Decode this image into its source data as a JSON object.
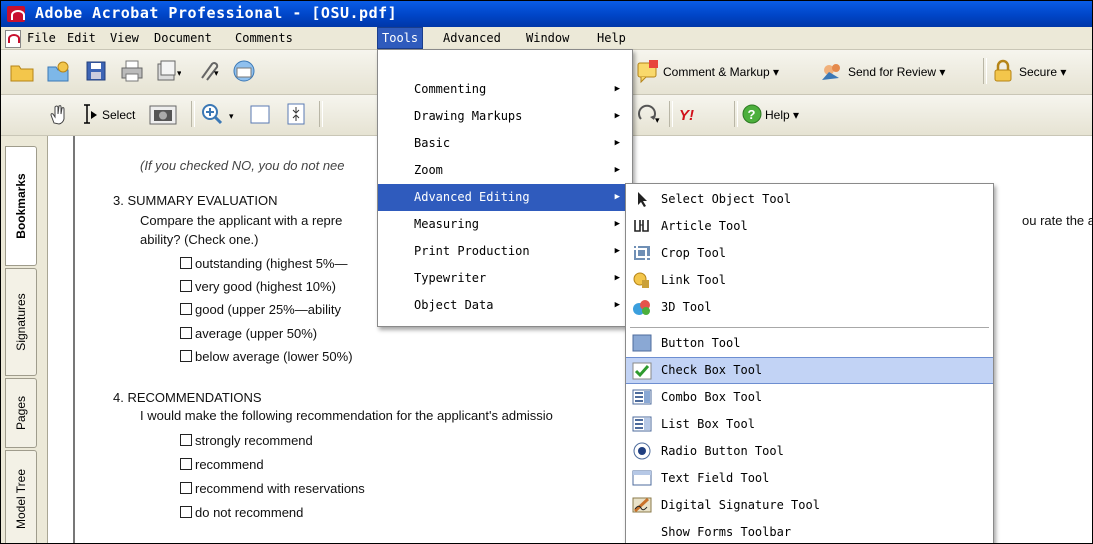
{
  "window": {
    "title": "Adobe Acrobat Professional - [OSU.pdf]"
  },
  "menubar": {
    "items": [
      {
        "label": "File"
      },
      {
        "label": "Edit"
      },
      {
        "label": "View"
      },
      {
        "label": "Document"
      },
      {
        "label": "Comments"
      },
      {
        "label": "Tools"
      },
      {
        "label": "Advanced"
      },
      {
        "label": "Window"
      },
      {
        "label": "Help"
      }
    ],
    "active": "Tools"
  },
  "toolbar1": {
    "comment_markup": "Comment & Markup ▾",
    "send_for_review": "Send for Review ▾",
    "secure": "Secure ▾"
  },
  "toolbar2": {
    "select_label": "Select",
    "help_label": "Help ▾"
  },
  "left_panel": {
    "tabs": [
      "Bookmarks",
      "Signatures",
      "Pages",
      "Model Tree"
    ]
  },
  "document": {
    "note": "(If you checked NO, you do not nee",
    "s3_heading": "3. SUMMARY EVALUATION",
    "s3_line1": "Compare the applicant with a repre",
    "s3_line1_cont": "ou rate the app",
    "s3_line2": "ability? (Check one.)",
    "s3_options": [
      "outstanding (highest 5%—",
      "very good (highest 10%)",
      "good (upper 25%—ability",
      "average (upper 50%)",
      "below average (lower 50%)"
    ],
    "s4_heading": "4. RECOMMENDATIONS",
    "s4_line1": "I would make the following recommendation for the applicant's admissio",
    "s4_options": [
      "strongly recommend",
      "recommend",
      "recommend with reservations",
      "do not recommend"
    ]
  },
  "tools_menu": {
    "items": [
      {
        "label": "Commenting",
        "has_submenu": true
      },
      {
        "label": "Drawing Markups",
        "has_submenu": true
      },
      {
        "label": "Basic",
        "has_submenu": true
      },
      {
        "label": "Zoom",
        "has_submenu": true
      },
      {
        "label": "Advanced Editing",
        "has_submenu": true,
        "highlighted": true
      },
      {
        "label": "Measuring",
        "has_submenu": true
      },
      {
        "label": "Print Production",
        "has_submenu": true
      },
      {
        "label": "Typewriter",
        "has_submenu": true
      },
      {
        "label": "Object Data",
        "has_submenu": true
      }
    ]
  },
  "advanced_editing_menu": {
    "items": [
      {
        "label": "Select Object Tool",
        "icon": "arrow-pointer-icon"
      },
      {
        "label": "Article Tool",
        "icon": "article-icon"
      },
      {
        "label": "Crop Tool",
        "icon": "crop-icon"
      },
      {
        "label": "Link Tool",
        "icon": "link-icon"
      },
      {
        "label": "3D Tool",
        "icon": "3d-icon"
      },
      {
        "label": "Button Tool",
        "icon": "button-icon"
      },
      {
        "label": "Check Box Tool",
        "icon": "checkbox-icon",
        "highlighted": true
      },
      {
        "label": "Combo Box Tool",
        "icon": "combo-box-icon"
      },
      {
        "label": "List Box Tool",
        "icon": "list-box-icon"
      },
      {
        "label": "Radio Button Tool",
        "icon": "radio-button-icon"
      },
      {
        "label": "Text Field Tool",
        "icon": "text-field-icon"
      },
      {
        "label": "Digital Signature Tool",
        "icon": "signature-icon"
      },
      {
        "label": "Show Forms Toolbar",
        "icon": ""
      }
    ]
  },
  "colors": {
    "title_bar": "#0045c7",
    "menu_highlight": "#2f5bbd",
    "submenu_highlight": "#c2d3f5"
  }
}
